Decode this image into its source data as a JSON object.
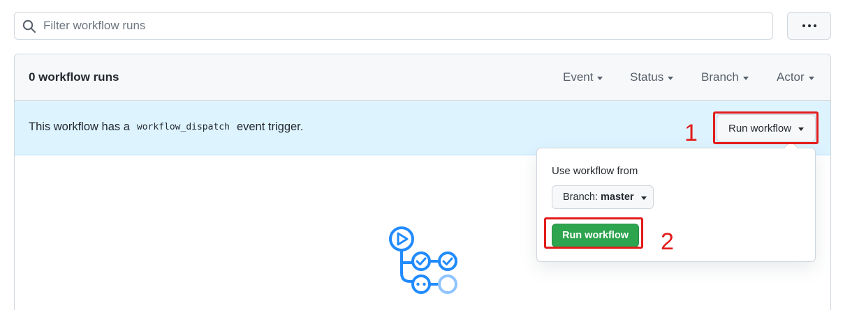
{
  "search": {
    "placeholder": "Filter workflow runs",
    "value": ""
  },
  "more_menu": {
    "icon": "kebab-horizontal-icon"
  },
  "header": {
    "runs_count": "0 workflow runs",
    "filters": [
      "Event",
      "Status",
      "Branch",
      "Actor"
    ]
  },
  "banner": {
    "text_before": "This workflow has a",
    "code": "workflow_dispatch",
    "text_after": "event trigger.",
    "run_button": "Run workflow"
  },
  "dropdown": {
    "title": "Use workflow from",
    "branch_prefix": "Branch:",
    "branch_value": "master",
    "submit": "Run workflow"
  },
  "annotations": {
    "step1": "1",
    "step2": "2"
  },
  "colors": {
    "accent_blue": "#218bff",
    "green": "#2da44e",
    "annotation_red": "#e31b1b",
    "banner_bg": "#ddf4ff"
  }
}
